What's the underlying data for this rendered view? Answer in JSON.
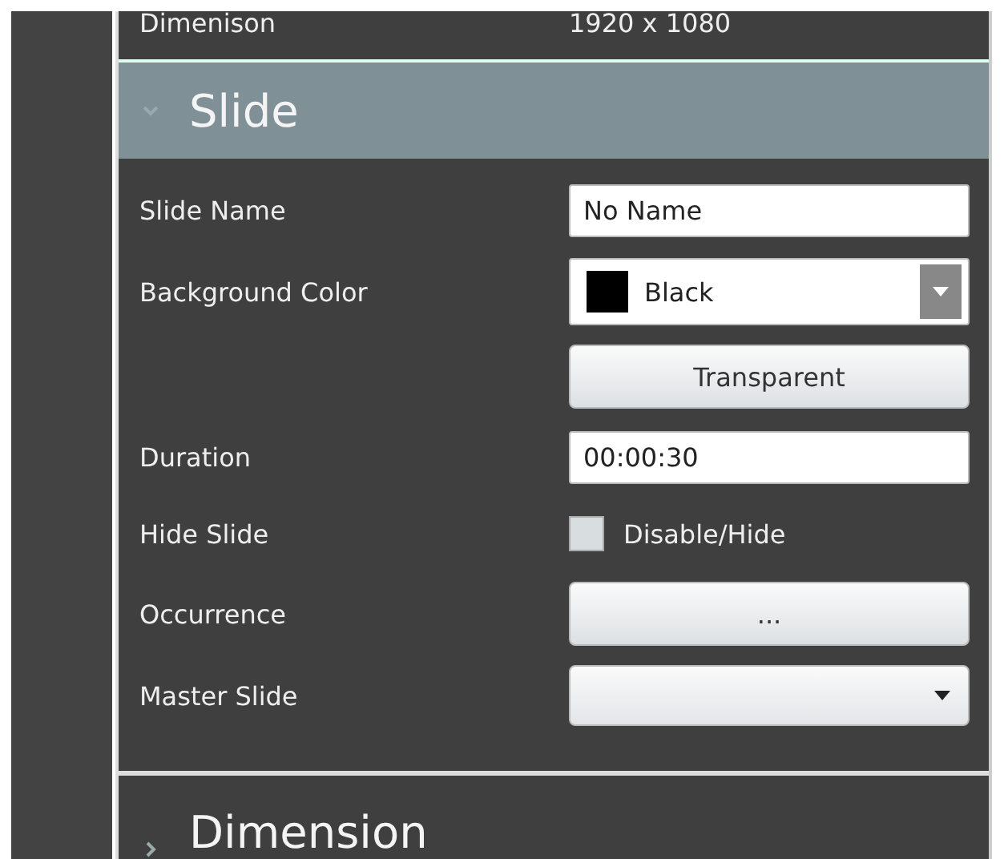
{
  "top_row": {
    "label": "Dimenison",
    "value": "1920 x 1080"
  },
  "section": {
    "title": "Slide",
    "expanded": true
  },
  "rows": [
    {
      "kind": "text",
      "label": "Slide Name",
      "value": "No Name"
    },
    {
      "kind": "color",
      "label": "Background Color",
      "value": "Black",
      "color": "#000000"
    },
    {
      "kind": "button",
      "text": "Transparent"
    },
    {
      "kind": "text",
      "label": "Duration",
      "value": "00:00:30"
    },
    {
      "kind": "checkbox",
      "label": "Hide Slide",
      "text": "Disable/Hide",
      "checked": false
    },
    {
      "kind": "button",
      "label": "Occurrence",
      "text": "..."
    },
    {
      "kind": "select",
      "label": "Master Slide"
    }
  ],
  "next_section": {
    "title": "Dimension",
    "expanded": false
  }
}
